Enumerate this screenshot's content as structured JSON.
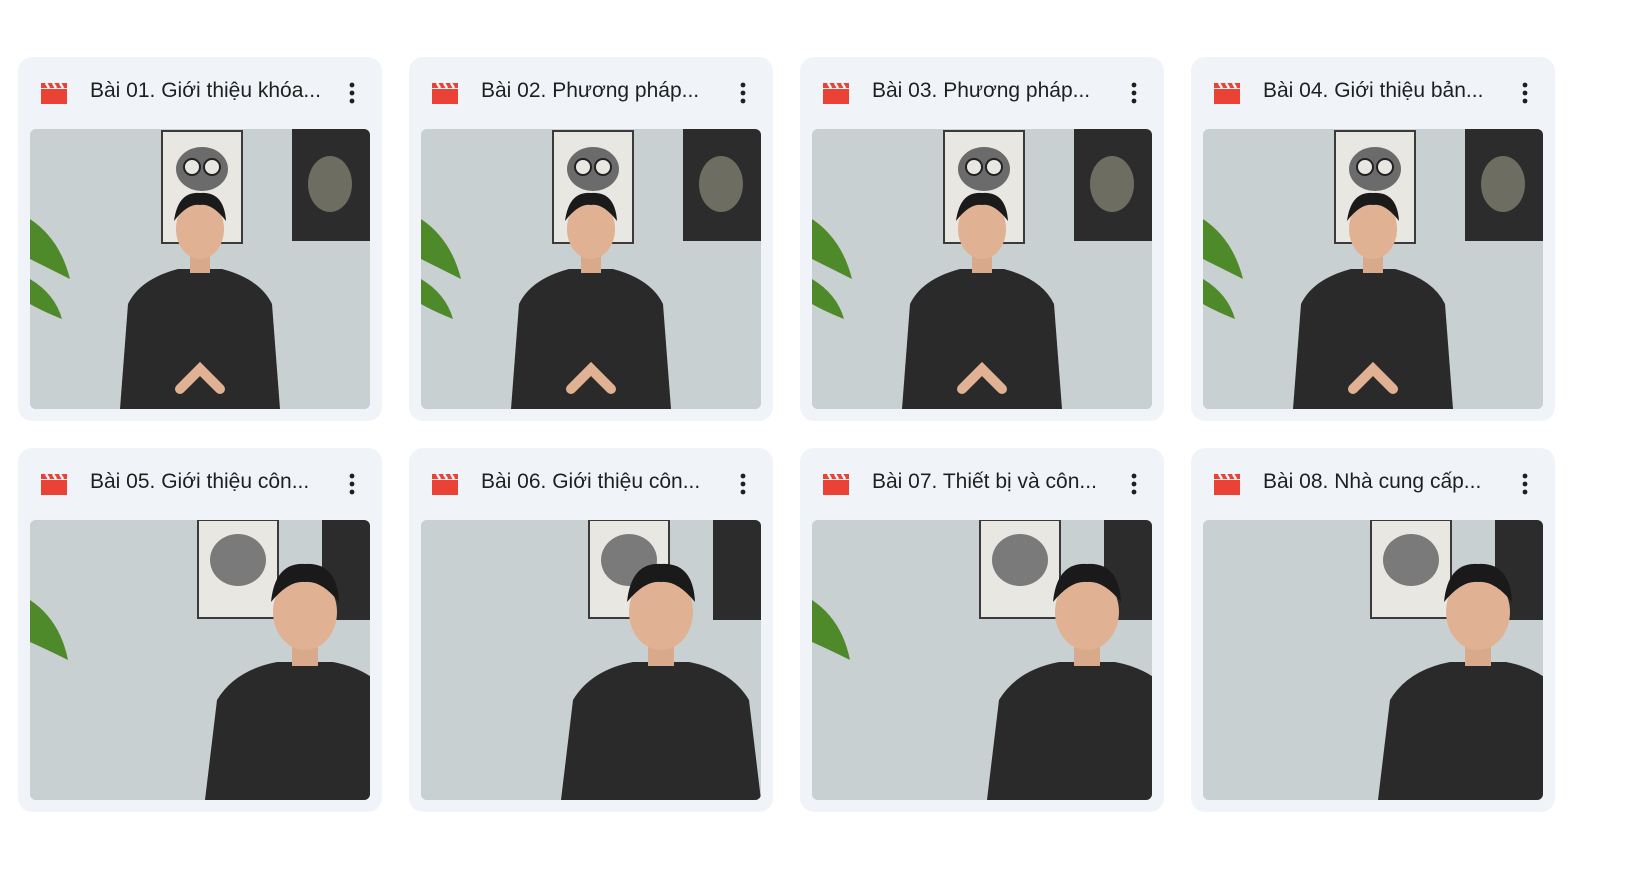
{
  "colors": {
    "card_background": "#f0f4f9",
    "video_icon": "#ea4335",
    "wall": "#c9d0d2",
    "shirt": "#2a2a2a",
    "plant": "#4f8a2a"
  },
  "icons": {
    "file_type": "video-clapper-icon",
    "more": "more-vert-icon"
  },
  "files": [
    {
      "title": "Bài 01. Giới thiệu khóa...",
      "pose": "center"
    },
    {
      "title": "Bài 02. Phương pháp...",
      "pose": "center"
    },
    {
      "title": "Bài 03. Phương pháp...",
      "pose": "center"
    },
    {
      "title": "Bài 04. Giới thiệu bản...",
      "pose": "center"
    },
    {
      "title": "Bài 05. Giới thiệu côn...",
      "pose": "close"
    },
    {
      "title": "Bài 06. Giới thiệu côn...",
      "pose": "close"
    },
    {
      "title": "Bài 07. Thiết bị và côn...",
      "pose": "close"
    },
    {
      "title": "Bài 08. Nhà cung cấp...",
      "pose": "close"
    }
  ]
}
